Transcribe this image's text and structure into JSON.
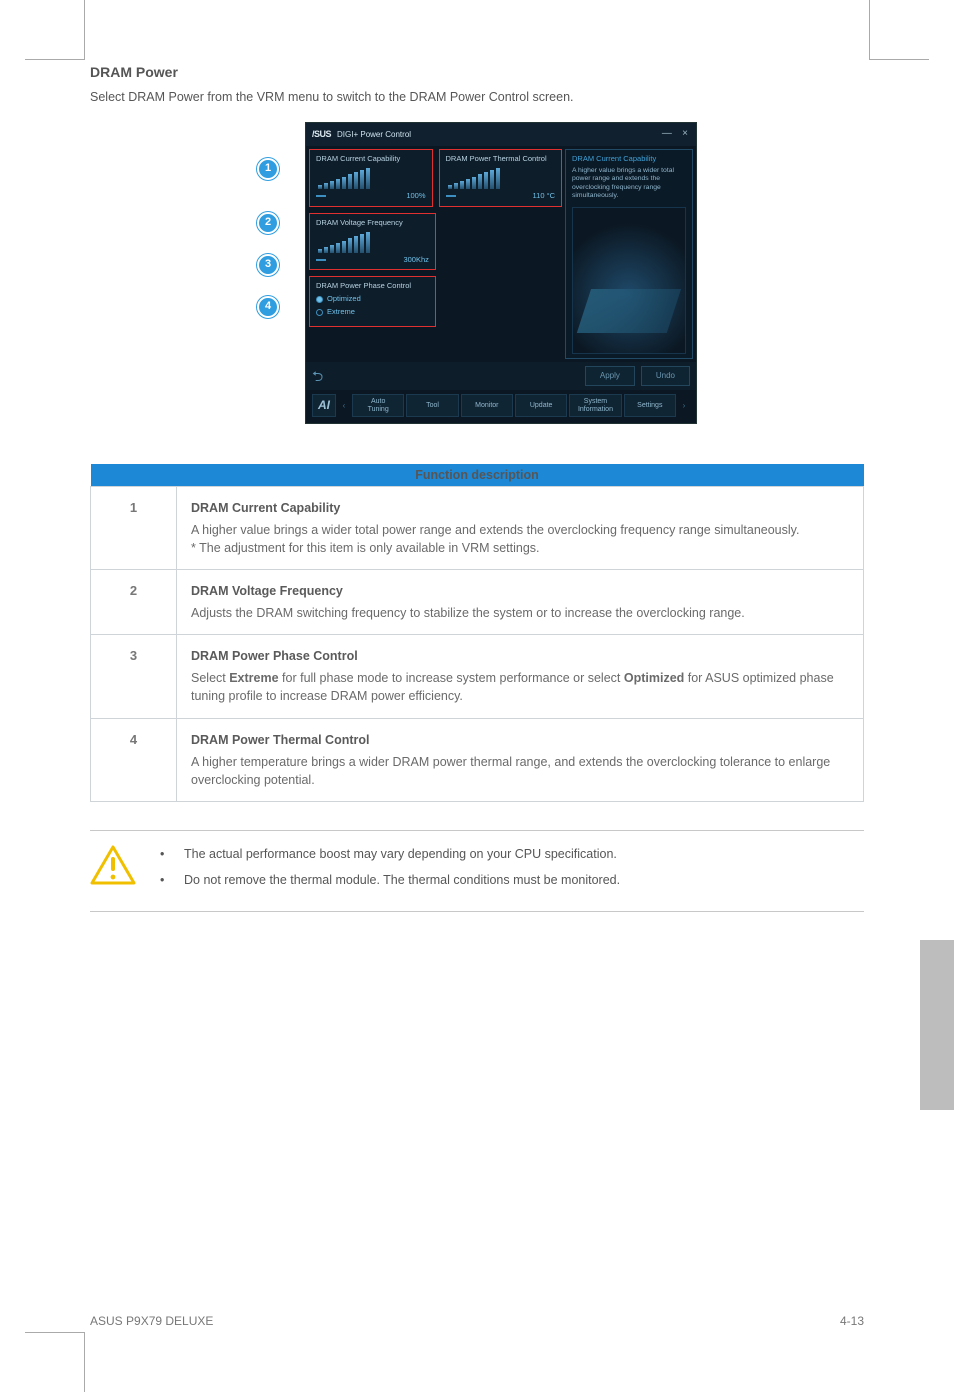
{
  "page": {
    "heading": "DRAM Power",
    "intro": "Select DRAM Power from the VRM menu to switch to the DRAM Power Control screen."
  },
  "app": {
    "brand": "/SUS",
    "title": "DIGI+ Power Control",
    "minimize": "—",
    "close": "×",
    "cards": {
      "current": {
        "title": "DRAM Current Capability",
        "value": "100%"
      },
      "thermal": {
        "title": "DRAM Power Thermal Control",
        "value": "110 °C"
      },
      "voltfreq": {
        "title": "DRAM Voltage Frequency",
        "value": "300Khz"
      },
      "phase": {
        "title": "DRAM Power Phase Control",
        "opt1": "Optimized",
        "opt2": "Extreme"
      }
    },
    "info": {
      "title": "DRAM Current Capability",
      "desc": "A higher value brings a wider total power range and extends the overclocking frequency range simultaneously."
    },
    "buttons": {
      "apply": "Apply",
      "undo": "Undo",
      "back": "⮌"
    },
    "nav": {
      "logo": "AI",
      "auto_tuning_l1": "Auto",
      "auto_tuning_l2": "Tuning",
      "tool": "Tool",
      "monitor": "Monitor",
      "update": "Update",
      "sysinfo_l1": "System",
      "sysinfo_l2": "Information",
      "settings": "Settings"
    }
  },
  "markers": {
    "m1": "1",
    "m2": "2",
    "m3": "3",
    "m4": "4"
  },
  "table": {
    "header": "Function description",
    "r1": {
      "num": "1",
      "name": "DRAM Current Capability",
      "desc": "A higher value brings a wider total power range and extends the overclocking frequency range simultaneously.",
      "note": "* The adjustment for this item is only available in VRM settings."
    },
    "r2": {
      "num": "2",
      "name": "DRAM Voltage Frequency",
      "desc": "Adjusts the DRAM switching frequency to stabilize the system or to increase the overclocking range."
    },
    "r3": {
      "num": "3",
      "name": "DRAM Power Phase Control",
      "desc_pre": "Select ",
      "opt_ext": "Extreme",
      "desc_mid1": " for full phase mode to increase system performance or select ",
      "opt_opt": "Optimized",
      "desc_mid2": " for ASUS optimized phase tuning profile to increase DRAM power efficiency."
    },
    "r4": {
      "num": "4",
      "name": "DRAM Power Thermal Control",
      "desc": "A higher temperature brings a wider DRAM power thermal range, and extends the overclocking tolerance to enlarge overclocking potential."
    }
  },
  "caution": {
    "b1": "The actual performance boost may vary depending on your CPU specification.",
    "b2": "Do not remove the thermal module. The thermal conditions must be monitored."
  },
  "footer": {
    "left": "ASUS P9X79 DELUXE",
    "right": "4-13"
  }
}
